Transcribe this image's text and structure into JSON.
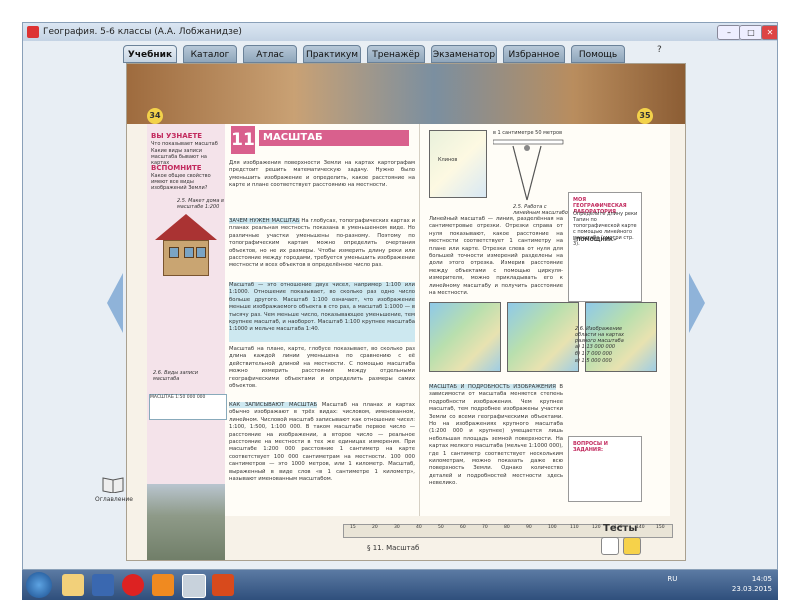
{
  "window": {
    "title": "География. 5-6 классы (А.А. Лобжанидзе)"
  },
  "menu": {
    "tabs": [
      "Учебник",
      "Каталог",
      "Атлас",
      "Практикум",
      "Тренажёр",
      "Экзаменатор",
      "Избранное",
      "Помощь"
    ],
    "active": "Учебник"
  },
  "book": {
    "page_left": "34",
    "page_right": "35",
    "chapter_number": "11",
    "chapter_title": "МАСШТАБ",
    "side_learn_head": "ВЫ УЗНАЕТЕ",
    "side_learn_items": [
      "Что показывает масштаб",
      "Какие виды записи масштаба бывают на картах"
    ],
    "side_recall_head": "ВСПОМНИТЕ",
    "side_recall_item": "Какое общее свойство имеют все виды изображений Земли?",
    "fig1_caption": "2.5. Макет дома в масштабе 1:200",
    "fig2_caption": "2.6. Виды записи масштаба",
    "scale_box": "МАСШТАБ 1:50 000 000",
    "intro": "Для изображения поверхности Земли на картах картографам предстоит решить математическую задачу. Нужно было уменьшить изображение и определить, какое расстояние на карте и плане соответствует расстоянию на местности.",
    "para1_head": "ЗАЧЕМ НУЖЕН МАСШТАБ",
    "para1": "На глобусах, топографических картах и планах реальная местность показана в уменьшенном виде. Но различные участки уменьшены по-разному. Поэтому по топографическим картам можно определить очертания объектов, но не их размеры. Чтобы измерить длину реки или расстояние между городами, требуется уменьшить изображение местности и всех объектов в определённое число раз.",
    "para2": "Масштаб — это отношение двух чисел, например 1:100 или 1:1000. Отношение показывает, во сколько раз одно число больше другого. Масштаб 1:100 означает, что изображение меньше изображаемого объекта в сто раз, а масштаб 1:1000 — в тысячу раз. Чем меньше число, показывающее уменьшение, тем крупнее масштаб, и наоборот. Масштаб 1:100 крупнее масштаба 1:1000 и мельче масштаба 1:40.",
    "para3": "Масштаб на плане, карте, глобусе показывает, во сколько раз длина каждой линии уменьшена по сравнению с её действительной длиной на местности. С помощью масштаба можно измерить расстояния между отдельными географическими объектами и определить размеры самих объектов.",
    "para4_head": "КАК ЗАПИСЫВАЮТ МАСШТАБ",
    "para4": "Масштаб на планах и картах обычно изображают в трёх видах: числовом, именованном, линейном. Числовой масштаб записывают как отношение чисел: 1:100, 1:500, 1:100 000. В таком масштабе первое число — расстояние на изображении, а второе число — реальное расстояние на местности в тех же единицах измерения. При масштабе 1:200 000 расстояние 1 сантиметр на карте соответствует 100 000 сантиметрам на местности. 100 000 сантиметров — это 1000 метров, или 1 километр. Масштаб, выраженный в виде слов «в 1 сантиметре 1 километр», называют именованным масштабом.",
    "ruler_label": "в 1 сантиметре 50 метров",
    "fig3_caption": "2.5. Работа с линейным масштабом",
    "topomap_label": "Клинов",
    "para5": "Линейный масштаб — линия, разделённая на сантиметровые отрезки. Отрезки справа от нуля показывают, какое расстояние на местности соответствует 1 сантиметру на плане или карте. Отрезки слева от нуля для большей точности измерений разделены на доли этого отрезка. Измерив расстояние между объектами с помощью циркуля-измерителя, можно прикладывать его к линейному масштабу и получить расстояние на местности.",
    "para6_head": "МАСШТАБ И ПОДРОБНОСТЬ ИЗОБРАЖЕНИЯ",
    "para6": "В зависимости от масштаба меняется степень подробности изображения. Чем крупнее масштаб, тем подробнее изображены участки Земли со всеми географическими объектами. Но на изображениях крупного масштаба (1:200 000 и крупнее) умещается лишь небольшая площадь земной поверхности. На картах мелкого масштаба (мельче 1:1000 000), где 1 сантиметр соответствует нескольким километрам, можно показать даже всю поверхность Земли. Однако количество деталей и подробностей местности здесь невелико.",
    "lab_head": "МОЯ ГЕОГРАФИЧЕСКАЯ ЛАБОРАТОРИЯ",
    "lab_text": "Определите длину реки Тапин по топографической карте с помощью линейного масштаба (смотри стр. 3).",
    "lab_help": "«ПОМОЩНИК»",
    "fig4_caption": "2.6. Изображение области на картах разного масштаба",
    "fig4_items": [
      "а) 1:13 000 000",
      "б) 1:7 000 000",
      "в) 1:5 000 000"
    ],
    "questions_head": "ВОПРОСЫ И ЗАДАНИЯ:",
    "ruler_ticks": [
      "15",
      "20",
      "30",
      "40",
      "50",
      "60",
      "70",
      "80",
      "90",
      "100",
      "110",
      "120",
      "130",
      "140",
      "150"
    ],
    "footer": "§ 11. Масштаб",
    "toc_label": "Оглавление",
    "tests_label": "Тесты"
  },
  "taskbar": {
    "lang": "RU",
    "time": "14:05",
    "date": "23.03.2015"
  },
  "colors": {
    "accent": "#d9608d",
    "highlight": "#cde8f0",
    "nav": "#8fb3d9"
  }
}
